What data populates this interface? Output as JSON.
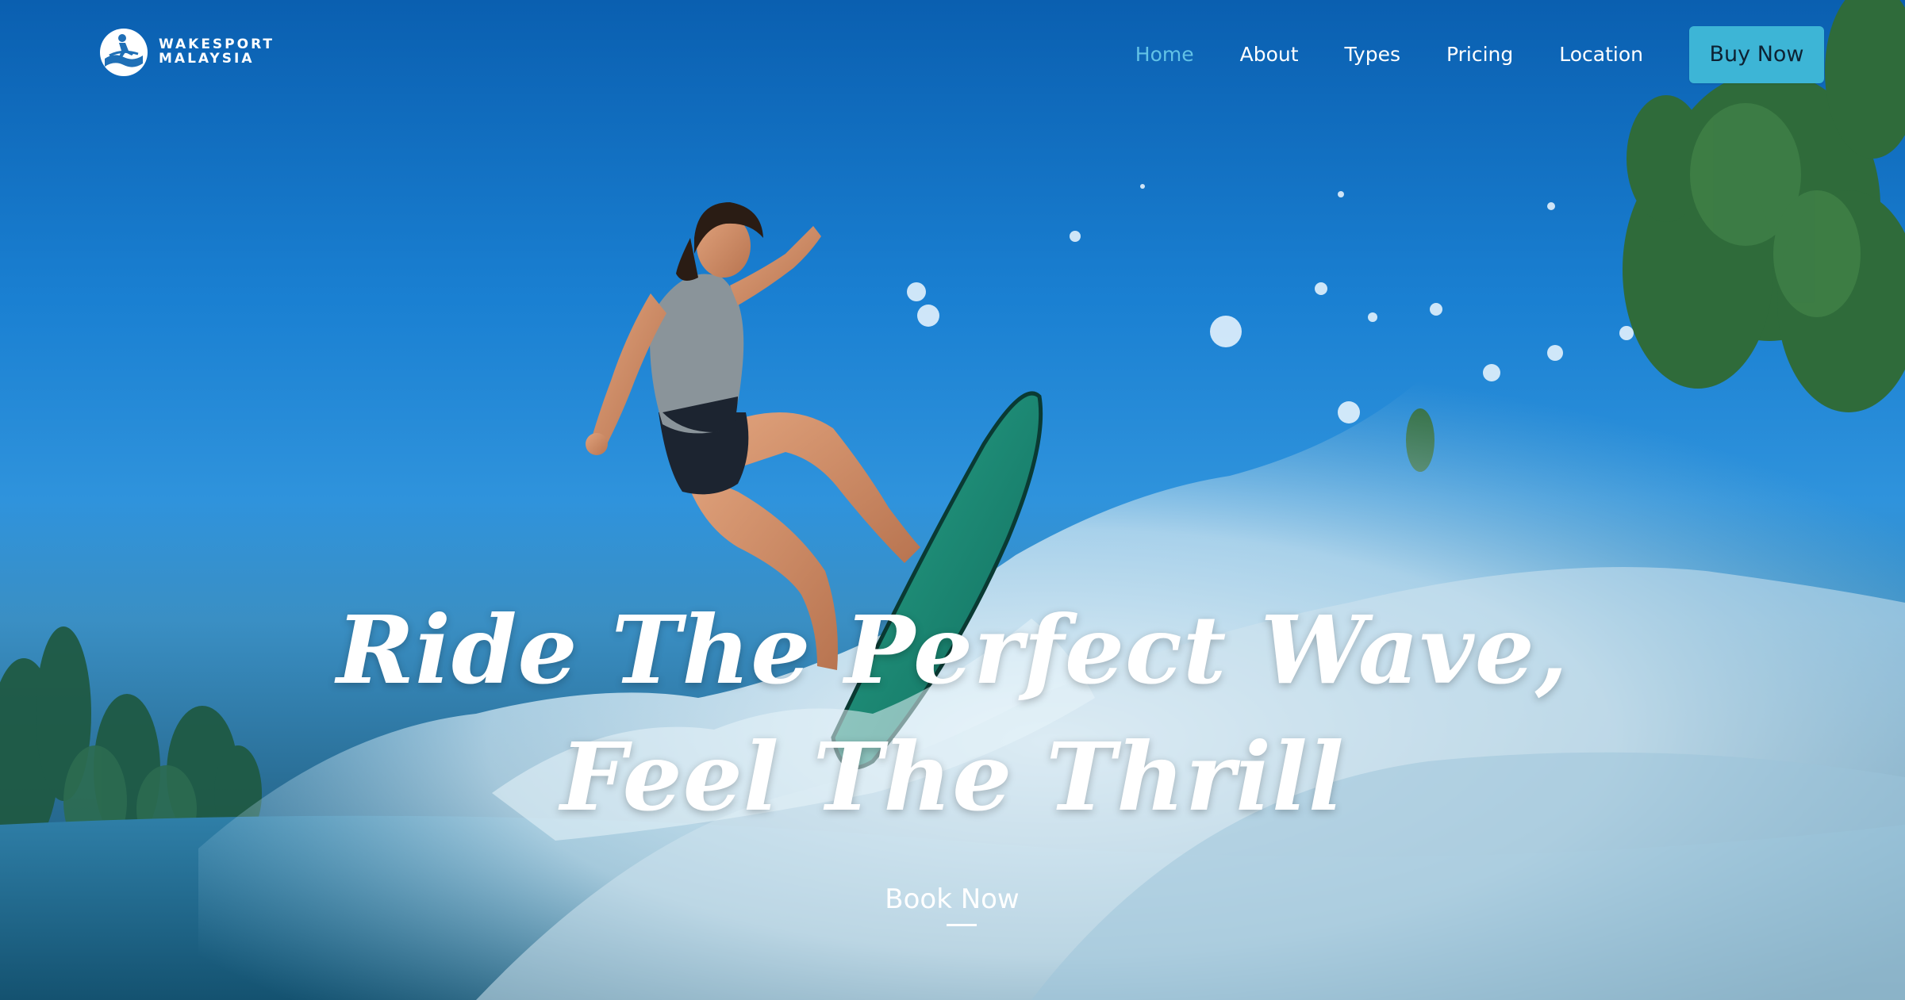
{
  "brand": {
    "line1": "WAKESPORT",
    "line2": "MALAYSIA",
    "logo_icon": "surfer-logo-icon"
  },
  "nav": {
    "items": [
      {
        "label": "Home",
        "active": true
      },
      {
        "label": "About",
        "active": false
      },
      {
        "label": "Types",
        "active": false
      },
      {
        "label": "Pricing",
        "active": false
      },
      {
        "label": "Location",
        "active": false
      }
    ],
    "cta_label": "Buy Now",
    "active_color": "#62c2e6",
    "cta_color": "#3db5d6"
  },
  "hero": {
    "headline_line1": "Ride The Perfect Wave,",
    "headline_line2": "Feel The Thrill",
    "cta_label": "Book Now"
  }
}
